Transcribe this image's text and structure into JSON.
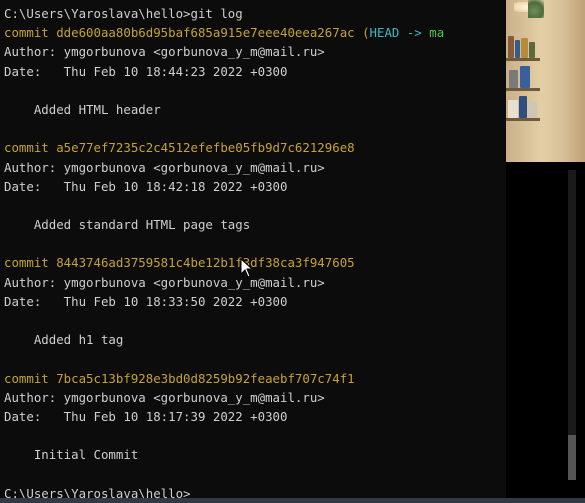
{
  "terminal": {
    "lines": [
      {
        "parts": [
          {
            "text": "C:\\Users\\Yaroslava\\hello>git log",
            "color": "#cfcfcf"
          }
        ]
      },
      {
        "parts": [
          {
            "text": "commit dde600aa80b6d95baf685a915e7eee40eea267ac",
            "color": "#c7a233"
          },
          {
            "text": " (",
            "color": "#c7a233"
          },
          {
            "text": "HEAD -> ",
            "color": "#3bb9c9"
          },
          {
            "text": "ma",
            "color": "#57c24b"
          }
        ]
      },
      {
        "parts": [
          {
            "text": "Author: ymgorbunova <gorbunova_y_m@mail.ru>",
            "color": "#cfcfcf"
          }
        ]
      },
      {
        "parts": [
          {
            "text": "Date:   Thu Feb 10 18:44:23 2022 +0300",
            "color": "#cfcfcf"
          }
        ]
      },
      {
        "parts": [
          {
            "text": "",
            "color": "#cfcfcf"
          }
        ]
      },
      {
        "parts": [
          {
            "text": "    Added HTML header",
            "color": "#cfcfcf"
          }
        ]
      },
      {
        "parts": [
          {
            "text": "",
            "color": "#cfcfcf"
          }
        ]
      },
      {
        "parts": [
          {
            "text": "commit a5e77ef7235c2c4512efefbe05fb9d7c621296e8",
            "color": "#c7a233"
          }
        ]
      },
      {
        "parts": [
          {
            "text": "Author: ymgorbunova <gorbunova_y_m@mail.ru>",
            "color": "#cfcfcf"
          }
        ]
      },
      {
        "parts": [
          {
            "text": "Date:   Thu Feb 10 18:42:18 2022 +0300",
            "color": "#cfcfcf"
          }
        ]
      },
      {
        "parts": [
          {
            "text": "",
            "color": "#cfcfcf"
          }
        ]
      },
      {
        "parts": [
          {
            "text": "    Added standard HTML page tags",
            "color": "#cfcfcf"
          }
        ]
      },
      {
        "parts": [
          {
            "text": "",
            "color": "#cfcfcf"
          }
        ]
      },
      {
        "parts": [
          {
            "text": "commit 8443746ad3759581c4be12b1f3df38ca3f947605",
            "color": "#c7a233"
          }
        ]
      },
      {
        "parts": [
          {
            "text": "Author: ymgorbunova <gorbunova_y_m@mail.ru>",
            "color": "#cfcfcf"
          }
        ]
      },
      {
        "parts": [
          {
            "text": "Date:   Thu Feb 10 18:33:50 2022 +0300",
            "color": "#cfcfcf"
          }
        ]
      },
      {
        "parts": [
          {
            "text": "",
            "color": "#cfcfcf"
          }
        ]
      },
      {
        "parts": [
          {
            "text": "    Added h1 tag",
            "color": "#cfcfcf"
          }
        ]
      },
      {
        "parts": [
          {
            "text": "",
            "color": "#cfcfcf"
          }
        ]
      },
      {
        "parts": [
          {
            "text": "commit 7bca5c13bf928e3bd0d8259b92feaebf707c74f1",
            "color": "#c7a233"
          }
        ]
      },
      {
        "parts": [
          {
            "text": "Author: ymgorbunova <gorbunova_y_m@mail.ru>",
            "color": "#cfcfcf"
          }
        ]
      },
      {
        "parts": [
          {
            "text": "Date:   Thu Feb 10 18:17:39 2022 +0300",
            "color": "#cfcfcf"
          }
        ]
      },
      {
        "parts": [
          {
            "text": "",
            "color": "#cfcfcf"
          }
        ]
      },
      {
        "parts": [
          {
            "text": "    Initial Commit",
            "color": "#cfcfcf"
          }
        ]
      },
      {
        "parts": [
          {
            "text": "",
            "color": "#cfcfcf"
          }
        ]
      },
      {
        "parts": [
          {
            "text": "C:\\Users\\Yaroslava\\hello>",
            "color": "#cfcfcf"
          }
        ]
      }
    ]
  },
  "colors": {
    "background": "#0c0c0c",
    "text": "#cfcfcf",
    "commit": "#c7a233",
    "head": "#3bb9c9",
    "branch": "#57c24b"
  },
  "icons": {
    "cursor": "mouse-pointer-icon"
  }
}
